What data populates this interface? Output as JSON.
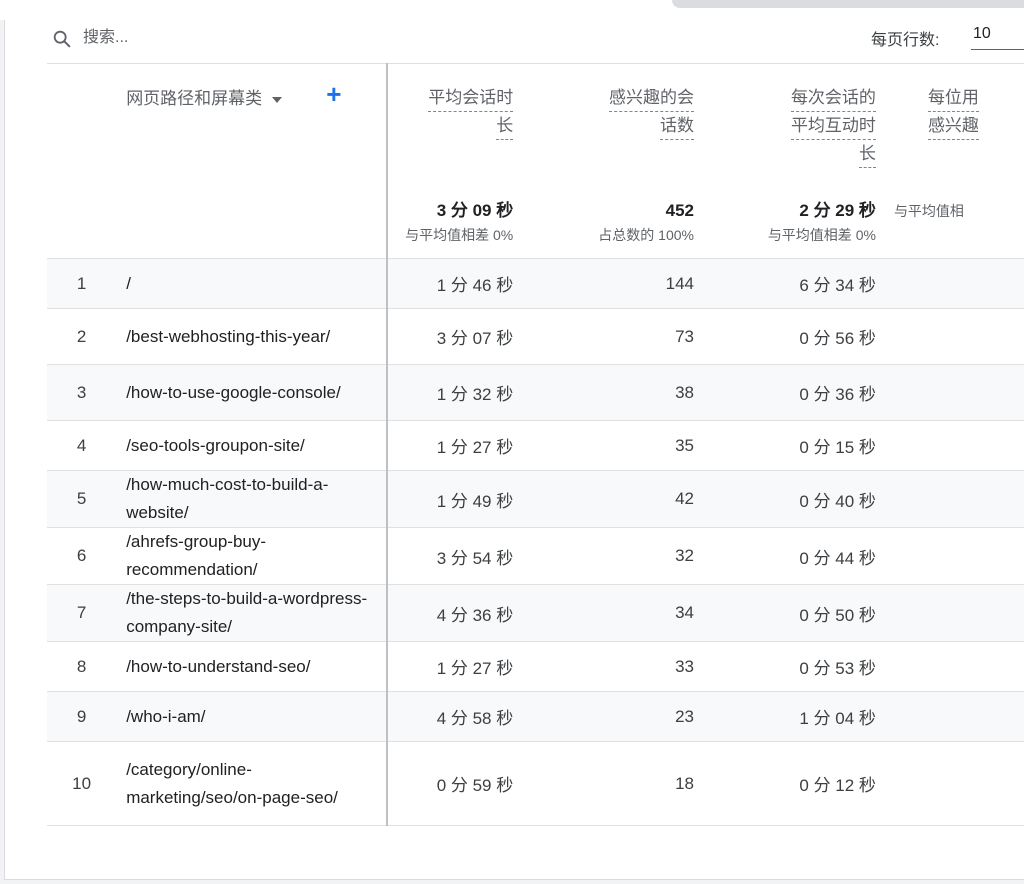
{
  "search": {
    "placeholder": "搜索..."
  },
  "pagination": {
    "rows_label": "每页行数:",
    "rows_value": "10"
  },
  "table": {
    "dimension_header": "网页路径和屏幕类",
    "metrics": [
      {
        "label_lines": [
          "平均会话时",
          "长"
        ],
        "total": "3 分 09 秒",
        "total_sub": "与平均值相差 0%"
      },
      {
        "label_lines": [
          "感兴趣的会",
          "话数"
        ],
        "total": "452",
        "total_sub": "占总数的 100%"
      },
      {
        "label_lines": [
          "每次会话的",
          "平均互动时",
          "长"
        ],
        "total": "2 分 29 秒",
        "total_sub": "与平均值相差 0%"
      },
      {
        "label_lines": [
          "每位用",
          "感兴趣"
        ],
        "total": "",
        "total_sub": "与平均值相"
      }
    ],
    "rows": [
      {
        "index": "1",
        "path": "/",
        "m1": "1 分 46 秒",
        "m2": "144",
        "m3": "6 分 34 秒"
      },
      {
        "index": "2",
        "path": "/best-webhosting-this-year/",
        "m1": "3 分 07 秒",
        "m2": "73",
        "m3": "0 分 56 秒"
      },
      {
        "index": "3",
        "path": "/how-to-use-google-console/",
        "m1": "1 分 32 秒",
        "m2": "38",
        "m3": "0 分 36 秒"
      },
      {
        "index": "4",
        "path": "/seo-tools-groupon-site/",
        "m1": "1 分 27 秒",
        "m2": "35",
        "m3": "0 分 15 秒"
      },
      {
        "index": "5",
        "path": "/how-much-cost-to-build-a-website/",
        "m1": "1 分 49 秒",
        "m2": "42",
        "m3": "0 分 40 秒"
      },
      {
        "index": "6",
        "path": "/ahrefs-group-buy-recommendation/",
        "m1": "3 分 54 秒",
        "m2": "32",
        "m3": "0 分 44 秒"
      },
      {
        "index": "7",
        "path": "/the-steps-to-build-a-wordpress-company-site/",
        "m1": "4 分 36 秒",
        "m2": "34",
        "m3": "0 分 50 秒"
      },
      {
        "index": "8",
        "path": "/how-to-understand-seo/",
        "m1": "1 分 27 秒",
        "m2": "33",
        "m3": "0 分 53 秒"
      },
      {
        "index": "9",
        "path": "/who-i-am/",
        "m1": "4 分 58 秒",
        "m2": "23",
        "m3": "1 分 04 秒"
      },
      {
        "index": "10",
        "path": "/category/online-marketing/seo/on-page-seo/",
        "m1": "0 分 59 秒",
        "m2": "18",
        "m3": "0 分 12 秒"
      }
    ]
  },
  "icons": {
    "search": "search-icon",
    "dropdown": "dropdown-triangle-icon",
    "add": "plus-icon"
  },
  "colors": {
    "accent": "#1a73e8",
    "alt_row": "#f8f9fa",
    "border": "#e0e0e0"
  }
}
